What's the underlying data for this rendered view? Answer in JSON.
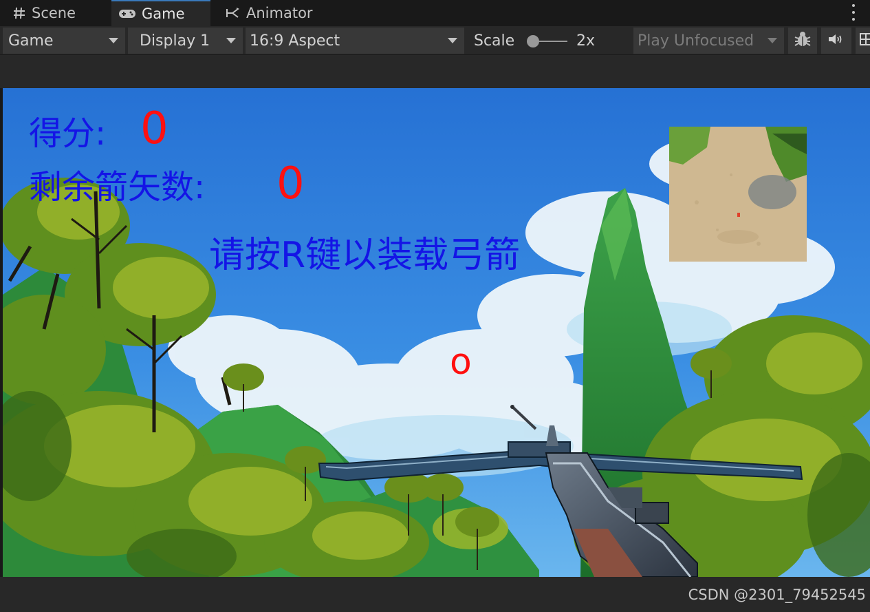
{
  "tabs": [
    {
      "label": "Scene",
      "icon": "hash-icon",
      "active": false
    },
    {
      "label": "Game",
      "icon": "gamepad-icon",
      "active": true
    },
    {
      "label": "Animator",
      "icon": "animator-icon",
      "active": false
    }
  ],
  "toolbar": {
    "view_dropdown": "Game",
    "display_dropdown": "Display 1",
    "aspect_dropdown": "16:9 Aspect",
    "scale_label": "Scale",
    "scale_value": "2x",
    "play_mode_dropdown": "Play Unfocused",
    "debug_icon": "bug-icon",
    "audio_icon": "speaker-icon",
    "stats_icon": "grid-icon"
  },
  "hud": {
    "score_label": "得分:",
    "score_value": "0",
    "arrows_label": "剩余箭矢数:",
    "arrows_value": "0",
    "prompt": "请按R键以装载弓箭",
    "crosshair": "o"
  },
  "colors": {
    "hud_text": "#1414e6",
    "hud_value": "#ff1010",
    "accent": "#3a79bb",
    "sky": "#2a7ad6"
  },
  "footer": {
    "watermark": "CSDN @2301_79452545"
  }
}
